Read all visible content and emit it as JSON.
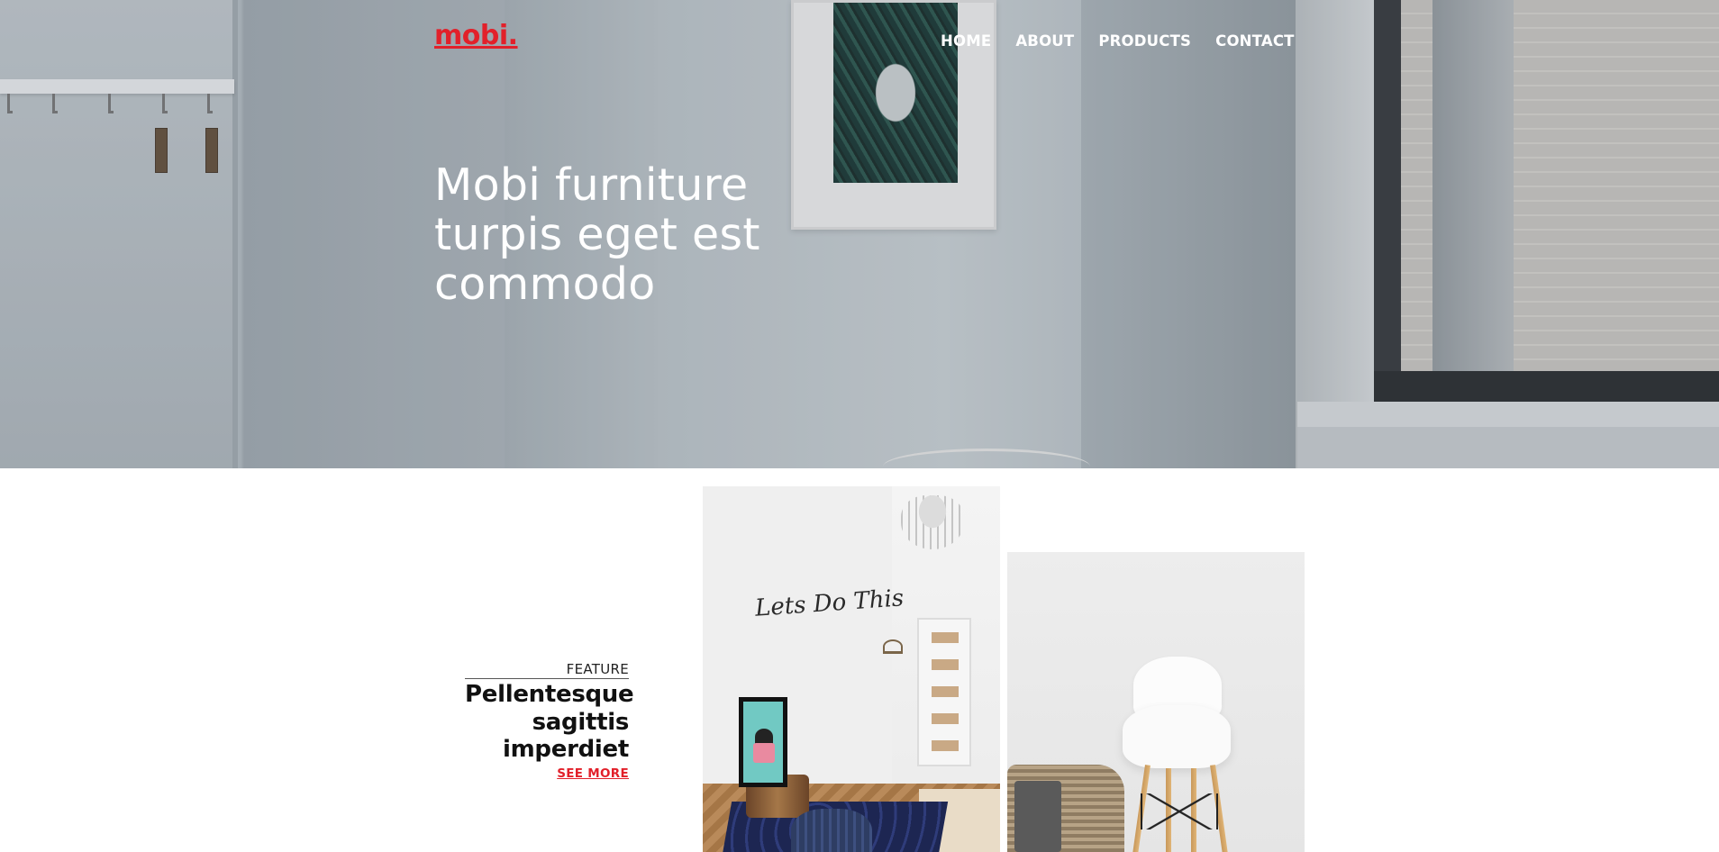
{
  "brand": {
    "logo": "mobi.",
    "accent_color": "#e2202a"
  },
  "nav": {
    "items": [
      "HOME",
      "ABOUT",
      "PRODUCTS",
      "CONTACT"
    ]
  },
  "hero": {
    "title": "Mobi furniture turpis eget est commodo"
  },
  "feature": {
    "label": "FEATURE",
    "heading": "Pellentesque sagittis imperdiet",
    "link": "SEE MORE"
  },
  "photos": {
    "room": {
      "lettering": "Lets Do This"
    }
  }
}
